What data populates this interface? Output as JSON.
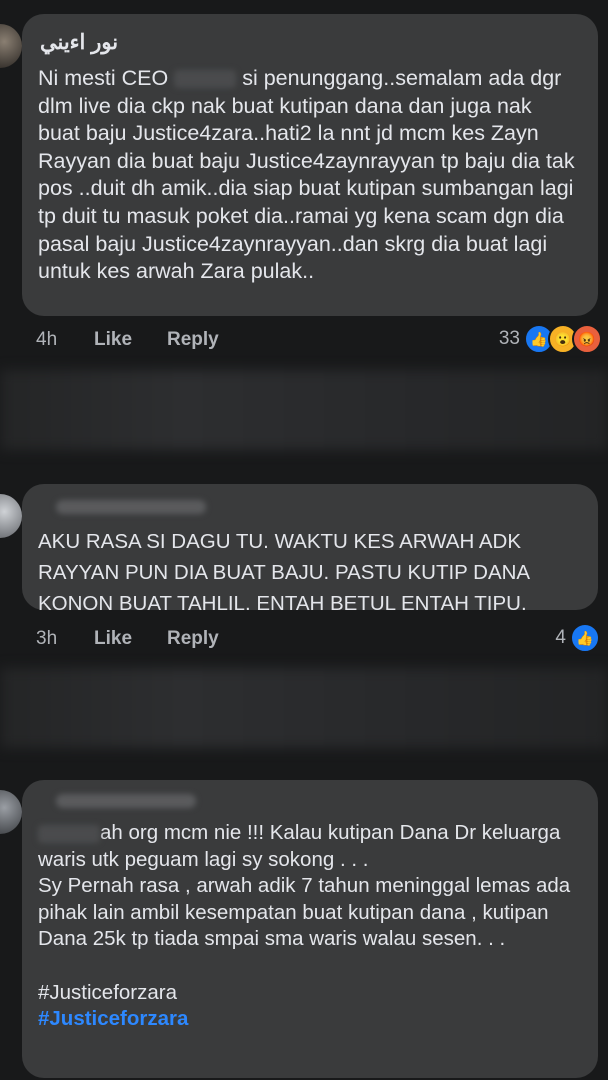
{
  "comments": [
    {
      "author": "نور اءيني",
      "text_pre": "Ni mesti CEO",
      "text_post": "si penunggang..semalam ada dgr dlm live dia ckp nak buat kutipan dana dan juga nak buat baju Justice4zara..hati2 la nnt jd mcm kes Zayn Rayyan dia buat baju Justice4zaynrayyan tp baju dia tak pos ..duit dh amik..dia siap buat kutipan sumbangan lagi tp duit tu masuk poket dia..ramai yg kena scam dgn dia pasal baju Justice4zaynrayyan..dan skrg dia buat lagi untuk kes arwah Zara pulak..",
      "time": "4h",
      "like_label": "Like",
      "reply_label": "Reply",
      "reaction_count": "33",
      "reactions": [
        "like-icon",
        "wow-icon",
        "angry-icon"
      ]
    },
    {
      "text": "AKU RASA SI DAGU TU. WAKTU KES ARWAH ADK RAYYAN PUN DIA BUAT BAJU. PASTU KUTIP DANA KONON BUAT TAHLIL. ENTAH BETUL ENTAH TIPU.",
      "time": "3h",
      "like_label": "Like",
      "reply_label": "Reply",
      "reaction_count": "4",
      "reactions": [
        "like-icon"
      ]
    },
    {
      "text_first": "ah org mcm nie !!! Kalau kutipan Dana Dr keluarga waris utk peguam lagi sy sokong . . .",
      "text_rest": "Sy Pernah rasa , arwah adik 7 tahun meninggal lemas ada pihak lain ambil kesempatan buat kutipan dana , kutipan Dana 25k tp tiada smpai sma waris walau sesen. . .",
      "hashtag_plain": "#Justiceforzara",
      "hashtag_link": "#Justiceforzara"
    }
  ],
  "colors": {
    "background": "#18191a",
    "bubble": "#3a3b3c",
    "text": "#e4e6eb",
    "secondary": "#b0b3b8",
    "link": "#2d88ff",
    "like_blue": "#1877f2"
  }
}
